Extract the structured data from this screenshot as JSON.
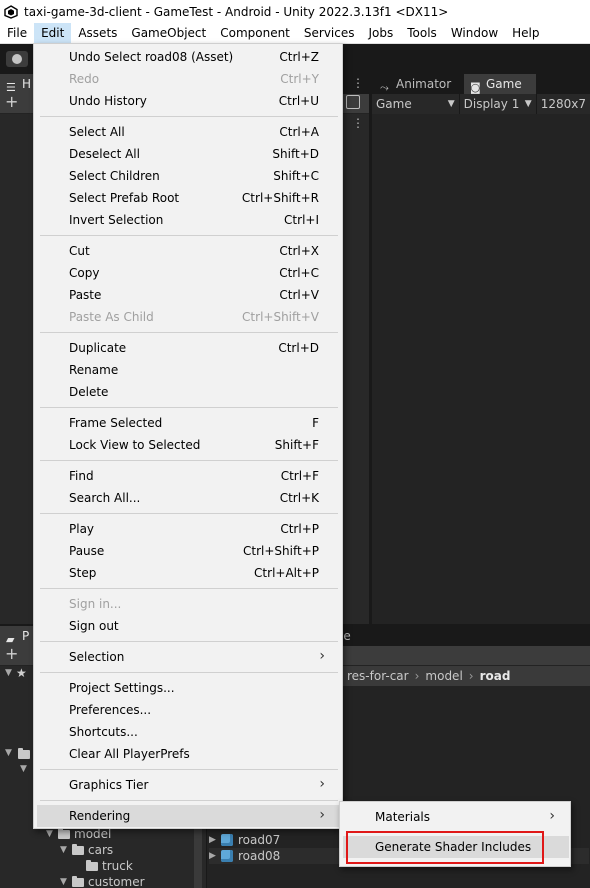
{
  "window": {
    "title": "taxi-game-3d-client - GameTest - Android - Unity 2022.3.13f1 <DX11>"
  },
  "menubar": {
    "items": [
      "File",
      "Edit",
      "Assets",
      "GameObject",
      "Component",
      "Services",
      "Jobs",
      "Tools",
      "Window",
      "Help"
    ]
  },
  "panels": {
    "hierarchy_tab": "H",
    "animator_tab": "Animator",
    "game_tab": "Game",
    "game_toolbar": {
      "view_select": "Game",
      "display_select": "Display 1",
      "resolution": "1280x7"
    },
    "project_tab": "P",
    "console_tab_fragment": "le",
    "breadcrumb": [
      "res-for-car",
      "model",
      "road"
    ],
    "tree": [
      {
        "label": "model"
      },
      {
        "label": "cars"
      },
      {
        "label": "truck"
      },
      {
        "label": "customer"
      }
    ],
    "assets": [
      {
        "label": "road07"
      },
      {
        "label": "road08"
      }
    ]
  },
  "edit_menu": {
    "items": [
      {
        "label": "Undo Select road08 (Asset)",
        "shortcut": "Ctrl+Z"
      },
      {
        "label": "Redo",
        "shortcut": "Ctrl+Y"
      },
      {
        "label": "Undo History",
        "shortcut": "Ctrl+U"
      },
      {
        "label": "Select All",
        "shortcut": "Ctrl+A"
      },
      {
        "label": "Deselect All",
        "shortcut": "Shift+D"
      },
      {
        "label": "Select Children",
        "shortcut": "Shift+C"
      },
      {
        "label": "Select Prefab Root",
        "shortcut": "Ctrl+Shift+R"
      },
      {
        "label": "Invert Selection",
        "shortcut": "Ctrl+I"
      },
      {
        "label": "Cut",
        "shortcut": "Ctrl+X"
      },
      {
        "label": "Copy",
        "shortcut": "Ctrl+C"
      },
      {
        "label": "Paste",
        "shortcut": "Ctrl+V"
      },
      {
        "label": "Paste As Child",
        "shortcut": "Ctrl+Shift+V"
      },
      {
        "label": "Duplicate",
        "shortcut": "Ctrl+D"
      },
      {
        "label": "Rename",
        "shortcut": ""
      },
      {
        "label": "Delete",
        "shortcut": ""
      },
      {
        "label": "Frame Selected",
        "shortcut": "F"
      },
      {
        "label": "Lock View to Selected",
        "shortcut": "Shift+F"
      },
      {
        "label": "Find",
        "shortcut": "Ctrl+F"
      },
      {
        "label": "Search All...",
        "shortcut": "Ctrl+K"
      },
      {
        "label": "Play",
        "shortcut": "Ctrl+P"
      },
      {
        "label": "Pause",
        "shortcut": "Ctrl+Shift+P"
      },
      {
        "label": "Step",
        "shortcut": "Ctrl+Alt+P"
      },
      {
        "label": "Sign in...",
        "shortcut": ""
      },
      {
        "label": "Sign out",
        "shortcut": ""
      },
      {
        "label": "Selection",
        "shortcut": ""
      },
      {
        "label": "Project Settings...",
        "shortcut": ""
      },
      {
        "label": "Preferences...",
        "shortcut": ""
      },
      {
        "label": "Shortcuts...",
        "shortcut": ""
      },
      {
        "label": "Clear All PlayerPrefs",
        "shortcut": ""
      },
      {
        "label": "Graphics Tier",
        "shortcut": ""
      },
      {
        "label": "Rendering",
        "shortcut": ""
      }
    ]
  },
  "rendering_submenu": {
    "items": [
      {
        "label": "Materials"
      },
      {
        "label": "Generate Shader Includes"
      }
    ]
  },
  "colors": {
    "menu_bg": "#f2f2f2",
    "editor_bg": "#282828",
    "highlight_box": "#e01818"
  }
}
